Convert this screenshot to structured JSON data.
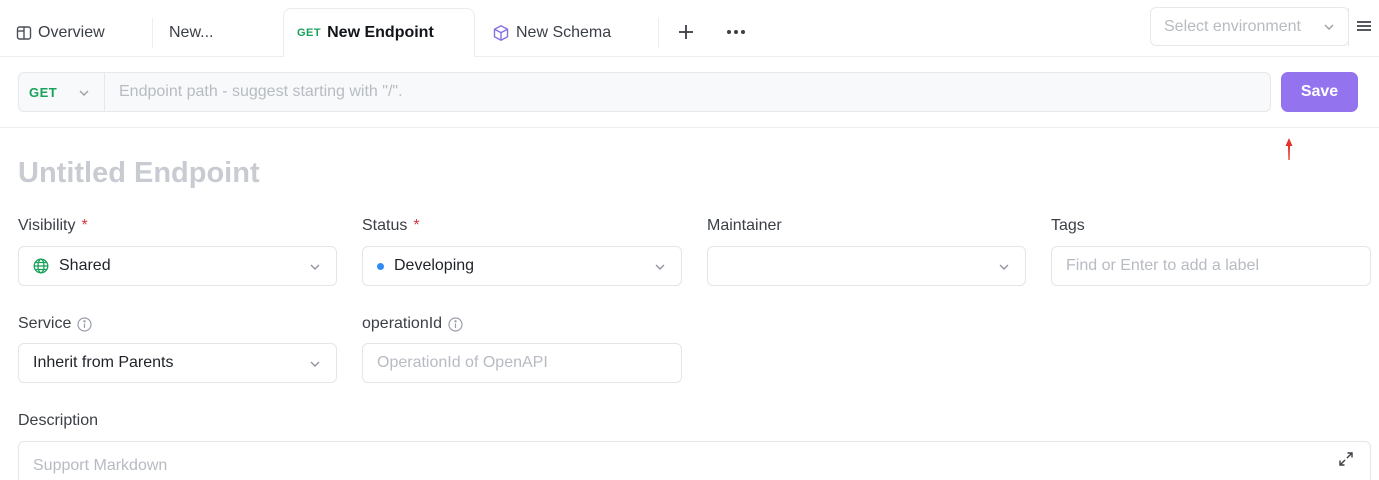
{
  "tabs": {
    "overview": {
      "label": "Overview",
      "icon": "book-icon"
    },
    "new": {
      "label": "New..."
    },
    "endpoint": {
      "method": "GET",
      "label": "New Endpoint"
    },
    "schema": {
      "label": "New Schema",
      "icon": "cube-icon"
    }
  },
  "environment": {
    "placeholder": "Select environment"
  },
  "request": {
    "method": "GET",
    "path_placeholder": "Endpoint path - suggest starting with \"/\".",
    "save_label": "Save"
  },
  "endpoint": {
    "title_placeholder": "Untitled Endpoint"
  },
  "form": {
    "visibility": {
      "label": "Visibility",
      "required": "*",
      "value": "Shared"
    },
    "status": {
      "label": "Status",
      "required": "*",
      "value": "Developing"
    },
    "maintainer": {
      "label": "Maintainer",
      "value": ""
    },
    "tags": {
      "label": "Tags",
      "placeholder": "Find or Enter to add a label"
    },
    "service": {
      "label": "Service",
      "value": "Inherit from Parents"
    },
    "operation_id": {
      "label": "operationId",
      "placeholder": "OperationId of OpenAPI"
    },
    "description": {
      "label": "Description",
      "placeholder": "Support Markdown"
    }
  },
  "colors": {
    "accent": "#9373ee",
    "get_method": "#19a25b",
    "status_dot": "#2f8bf5",
    "required": "#d4373a"
  }
}
